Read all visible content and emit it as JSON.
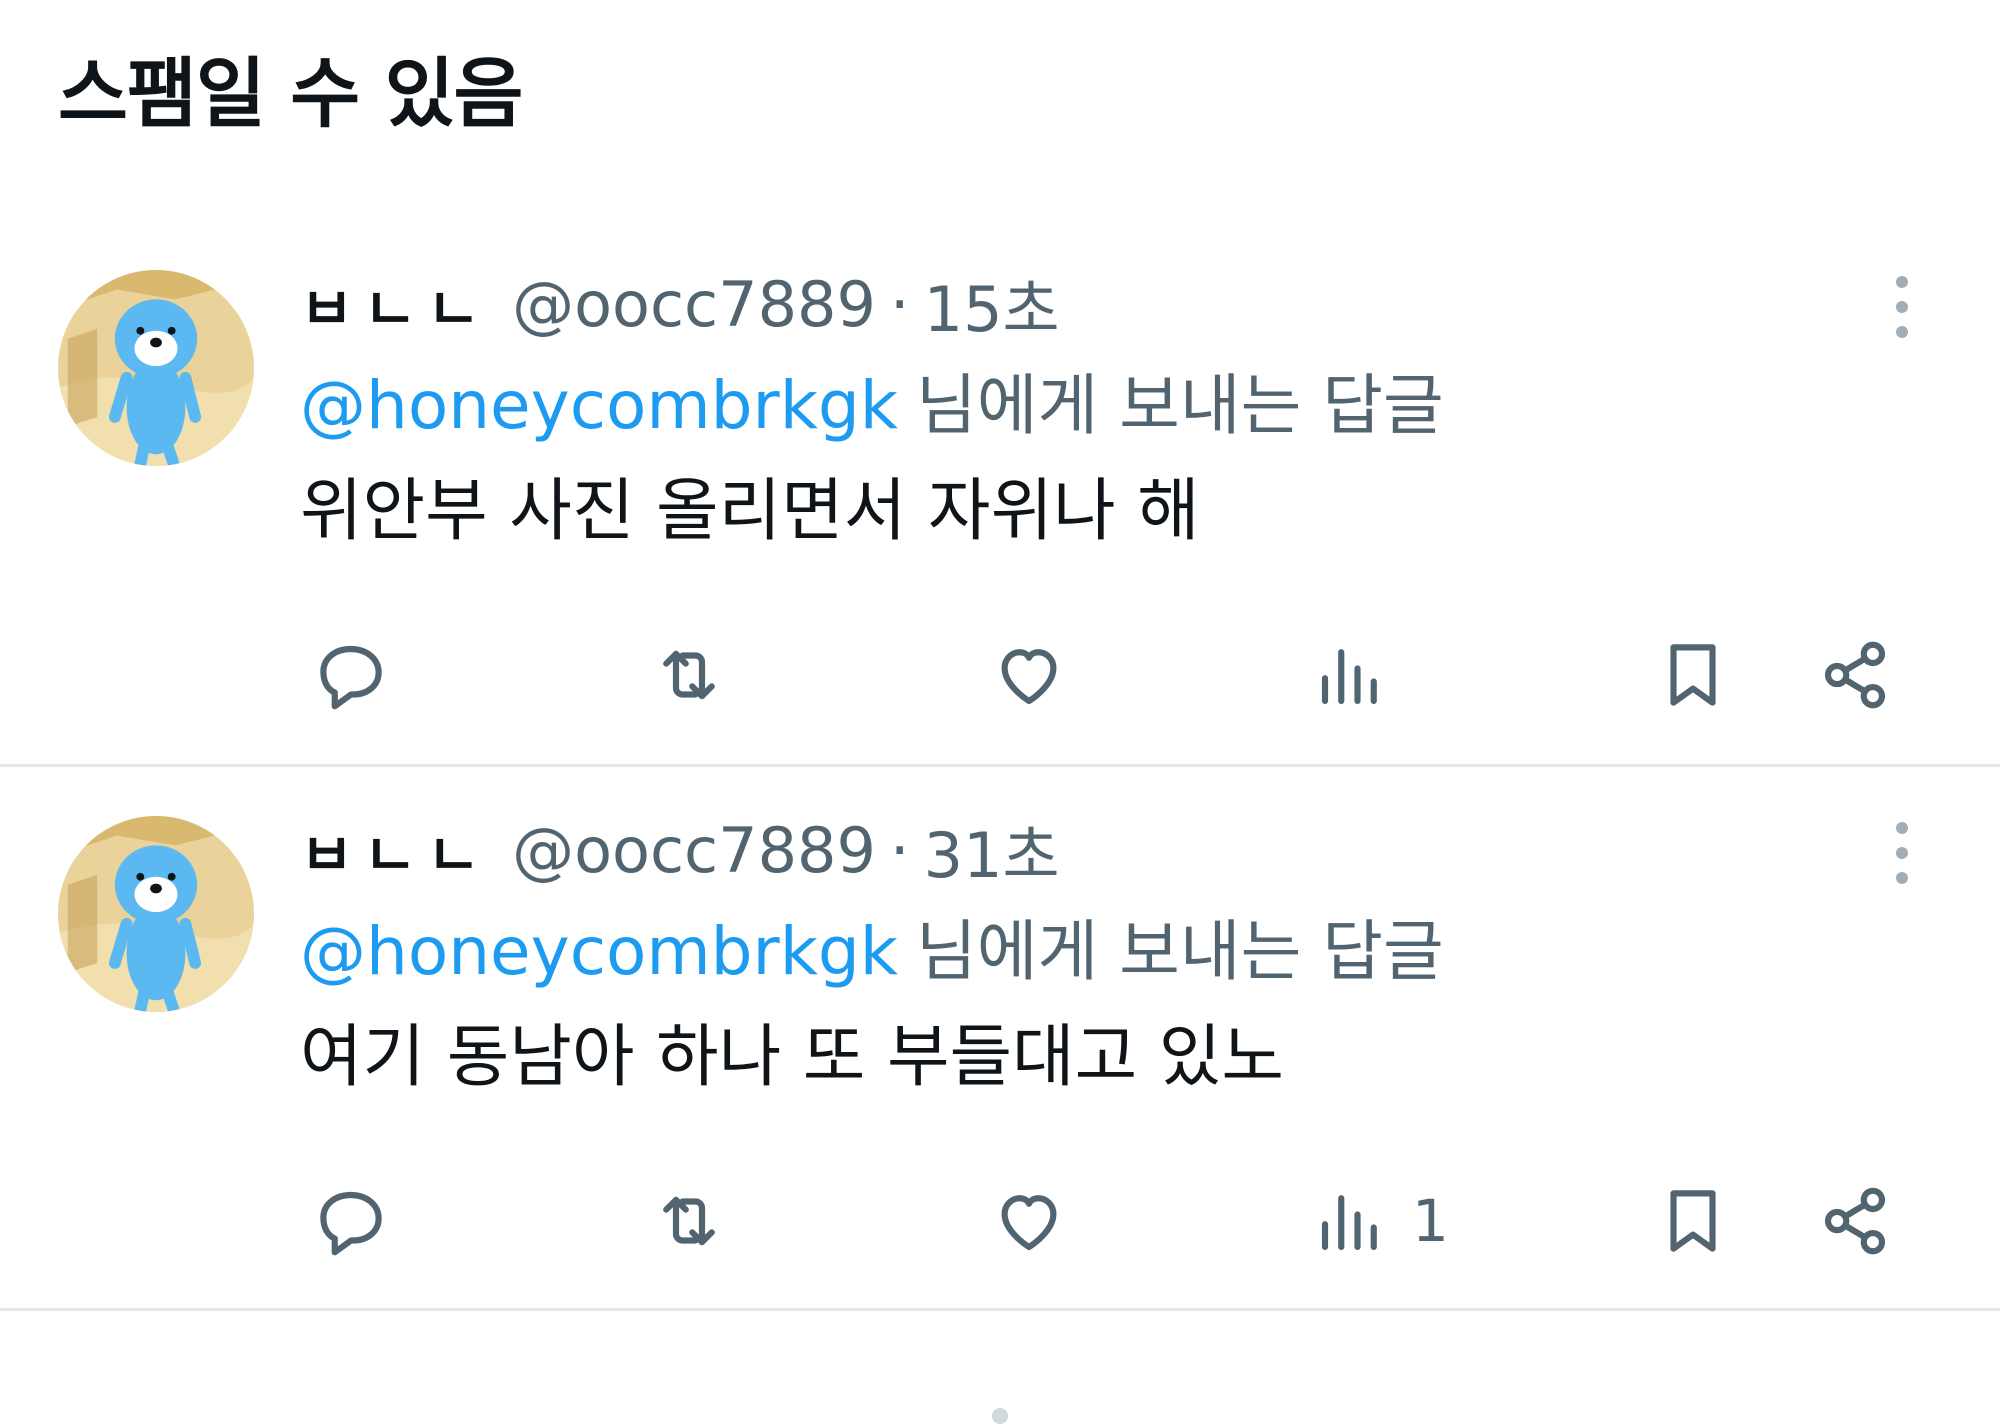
{
  "section": {
    "title": "스팸일 수 있음"
  },
  "tweets": [
    {
      "display_name": "ㅂㄴㄴ",
      "handle": "@oocc7889",
      "separator": "·",
      "time": "15초",
      "reply_to_mention": "@honeycombrkgk",
      "reply_to_suffix": "님에게 보내는 답글",
      "text": "위안부 사진 올리면서 자위나 해",
      "views_count": ""
    },
    {
      "display_name": "ㅂㄴㄴ",
      "handle": "@oocc7889",
      "separator": "·",
      "time": "31초",
      "reply_to_mention": "@honeycombrkgk",
      "reply_to_suffix": "님에게 보내는 답글",
      "text": "여기 동남아 하나 또 부들대고 있노",
      "views_count": "1"
    }
  ],
  "icons": {
    "reply": "reply-icon",
    "retweet": "retweet-icon",
    "like": "heart-icon",
    "views": "views-icon",
    "bookmark": "bookmark-icon",
    "share": "share-icon",
    "more": "more-icon"
  },
  "colors": {
    "link": "#1d9bf0",
    "secondary_text": "#536471",
    "primary_text": "#0f1419",
    "divider": "#e1e6ea",
    "avatar_character": "#5bb8f0"
  }
}
